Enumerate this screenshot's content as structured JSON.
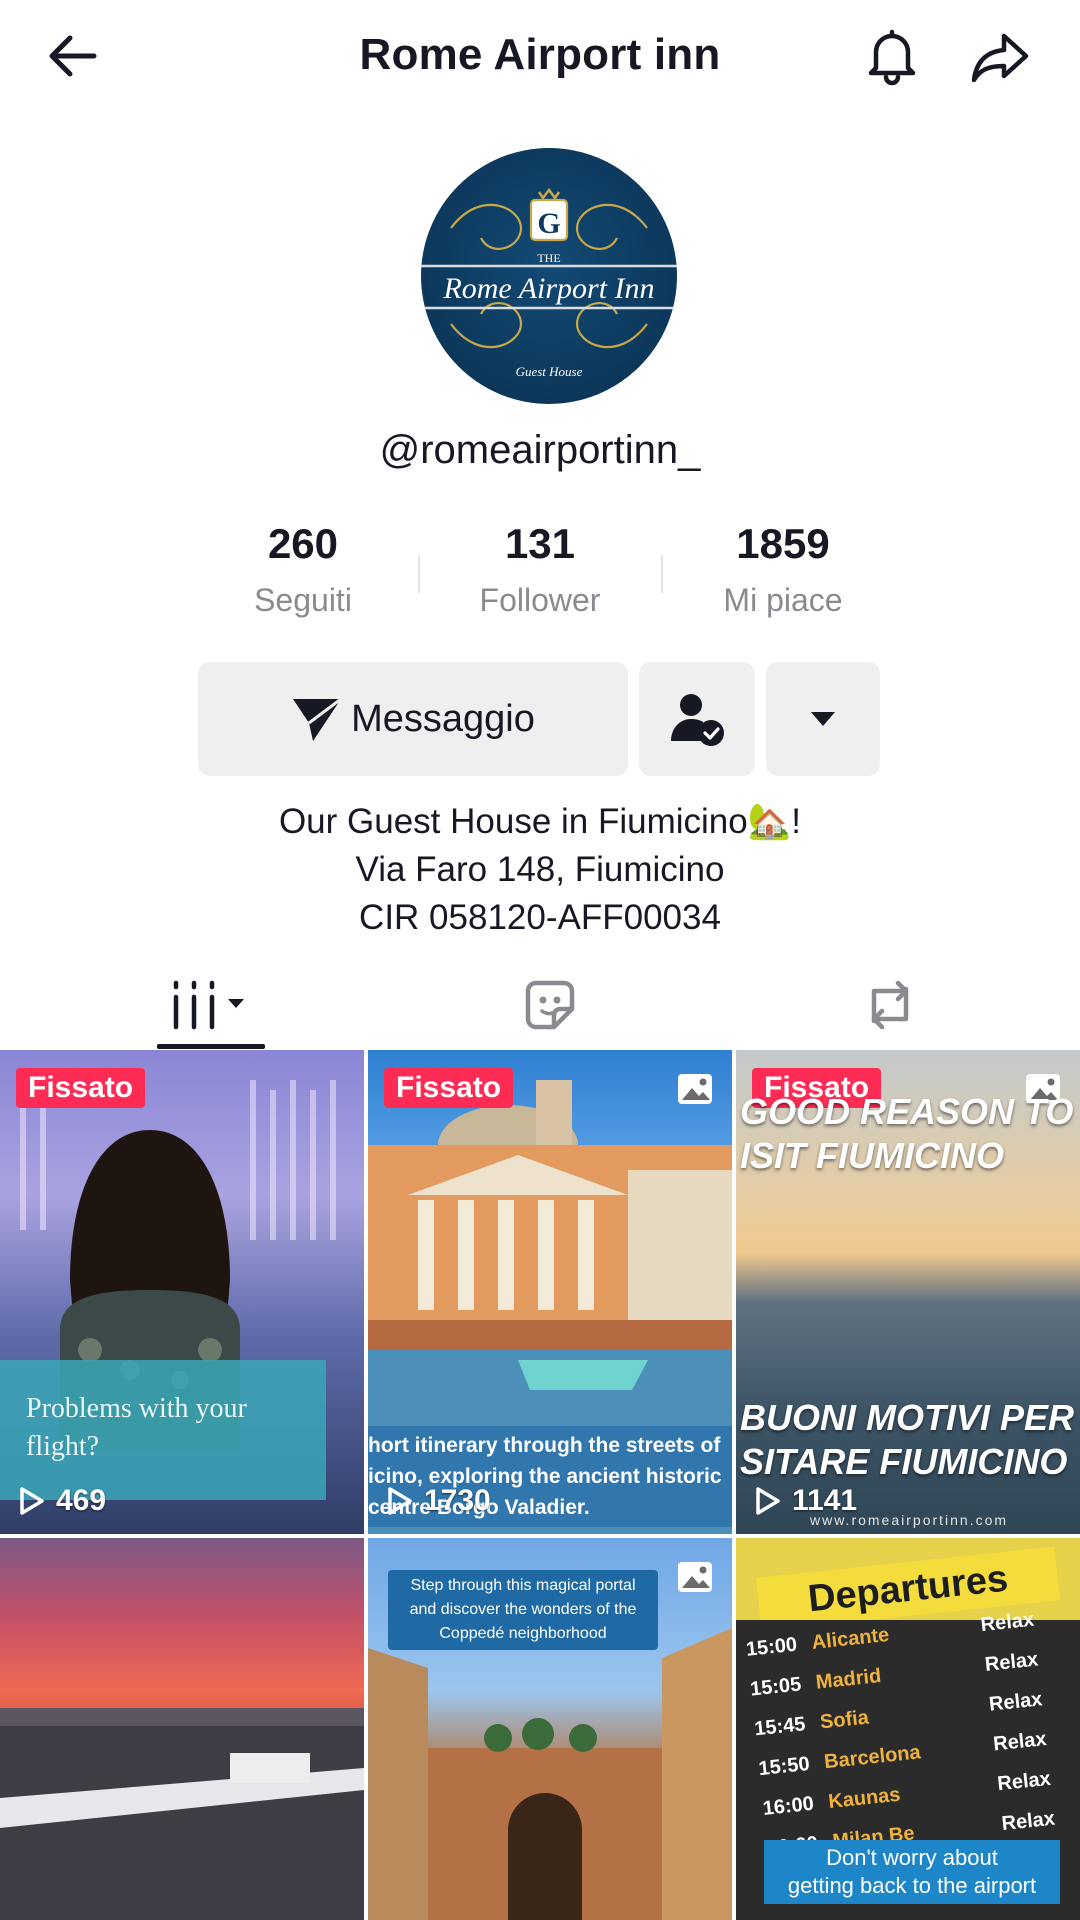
{
  "header": {
    "title": "Rome Airport inn"
  },
  "profile": {
    "avatar_text": {
      "monogram": "G",
      "the": "THE",
      "name": "Rome Airport Inn",
      "sub": "Guest House"
    },
    "handle": "@romeairportinn_"
  },
  "stats": [
    {
      "value": "260",
      "label": "Seguiti"
    },
    {
      "value": "131",
      "label": "Follower"
    },
    {
      "value": "1859",
      "label": "Mi piace"
    }
  ],
  "actions": {
    "message_label": "Messaggio"
  },
  "bio": {
    "line1": "Our Guest House in Fiumicino🏡!",
    "line2": "Via Faro 148, Fiumicino",
    "line3": "CIR 058120-AFF00034"
  },
  "videos": [
    {
      "pinned": "Fissato",
      "views": "469",
      "caption": "Problems with your flight?"
    },
    {
      "pinned": "Fissato",
      "views": "1730",
      "caption": "hort itinerary through the streets of\nicino, exploring the ancient historic\ncentre Borgo Valadier."
    },
    {
      "pinned": "Fissato",
      "views": "1141",
      "caption_top": "GOOD REASON TO\nISIT FIUMICINO",
      "caption_bottom": "BUONI MOTIVI PER\nSITARE FIUMICINO",
      "url": "www.romeairportinn.com"
    },
    {
      "caption": ""
    },
    {
      "caption": "Step through this magical portal\nand discover the wonders of the\nCoppedé neighborhood"
    },
    {
      "board_title": "Departures",
      "rows": [
        {
          "time": "15:00",
          "city": "Alicante",
          "status": "Relax"
        },
        {
          "time": "15:05",
          "city": "Madrid",
          "status": "Relax"
        },
        {
          "time": "15:45",
          "city": "Sofia",
          "status": "Relax"
        },
        {
          "time": "15:50",
          "city": "Barcelona",
          "status": "Relax"
        },
        {
          "time": "16:00",
          "city": "Kaunas",
          "status": "Relax"
        },
        {
          "time": "16:00",
          "city": "Milan Be",
          "status": "Relax"
        }
      ],
      "caption": "Don't worry about\ngetting back to the airport"
    }
  ],
  "colors": {
    "accent": "#fe2c55",
    "text": "#161823",
    "muted": "#8a8b91",
    "button_bg": "#efefef"
  }
}
